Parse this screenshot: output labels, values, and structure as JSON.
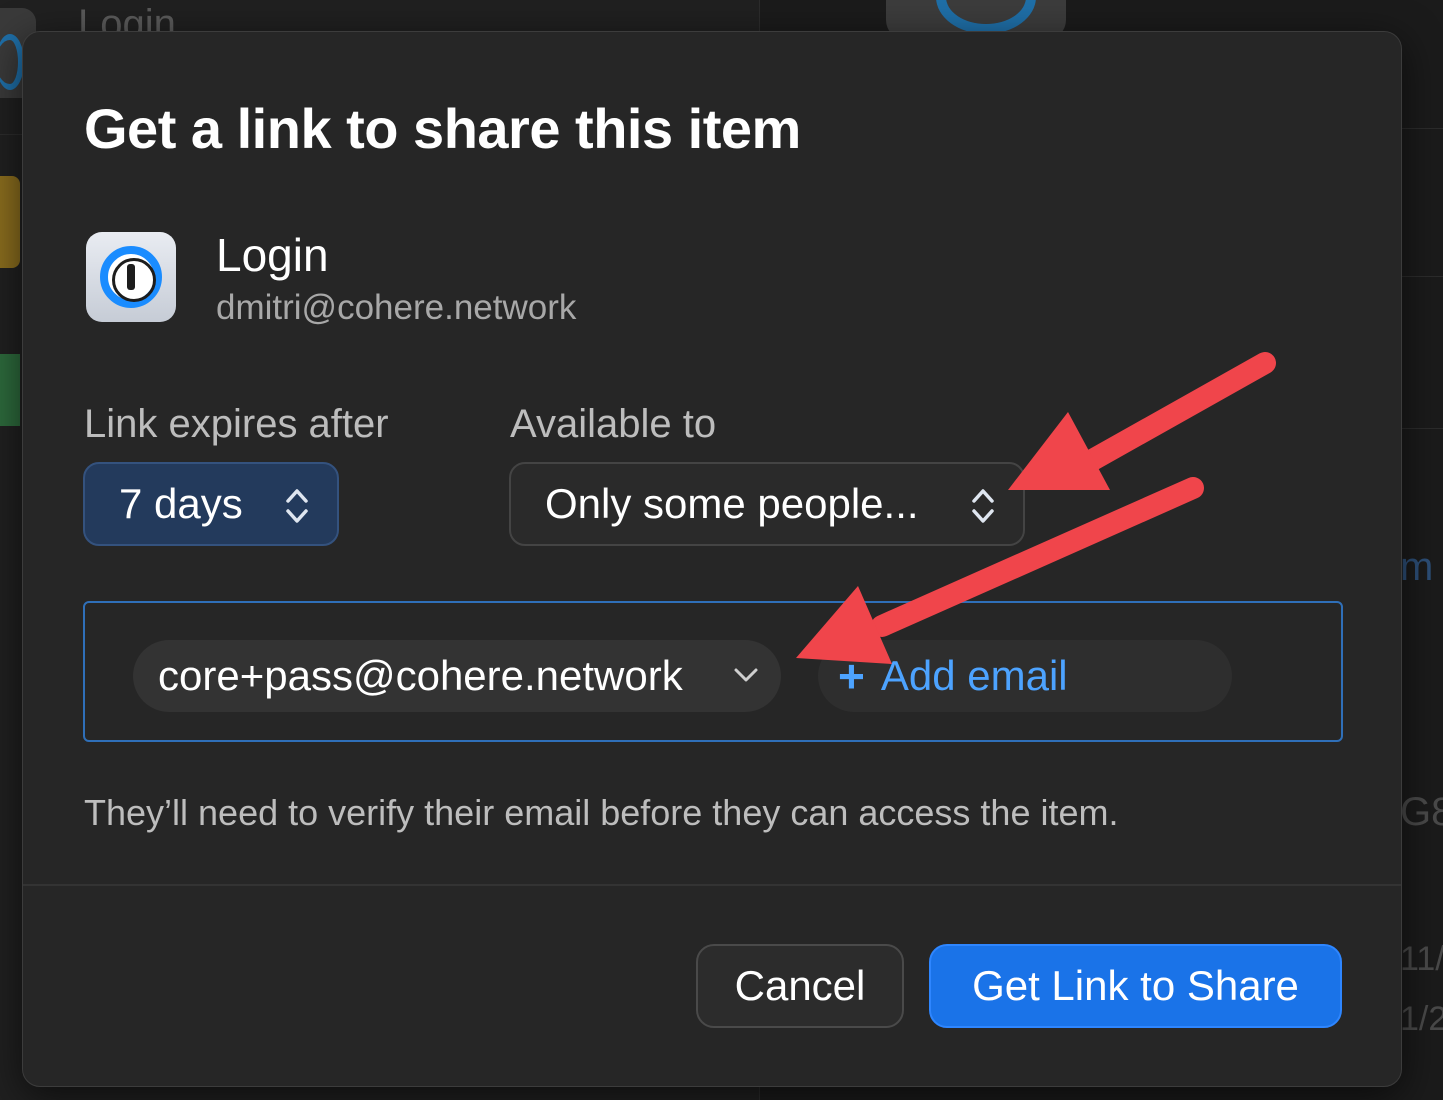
{
  "background": {
    "title": "Login",
    "right_texts": [
      "m",
      "G8",
      "11/",
      "1/2"
    ]
  },
  "dialog": {
    "title": "Get a link to share this item",
    "item": {
      "name": "Login",
      "subtitle": "dmitri@cohere.network",
      "icon": "1password-icon"
    },
    "expires": {
      "label": "Link expires after",
      "value": "7 days"
    },
    "available": {
      "label": "Available to",
      "value": "Only some people..."
    },
    "recipients": {
      "emails": [
        "core+pass@cohere.network"
      ],
      "add_label": "Add email"
    },
    "note": "They’ll need to verify their email before they can access the item.",
    "buttons": {
      "cancel": "Cancel",
      "primary": "Get Link to Share"
    }
  },
  "colors": {
    "accent": "#1a73e8",
    "link": "#4da3ff",
    "annotation_arrow": "#f0454b"
  }
}
